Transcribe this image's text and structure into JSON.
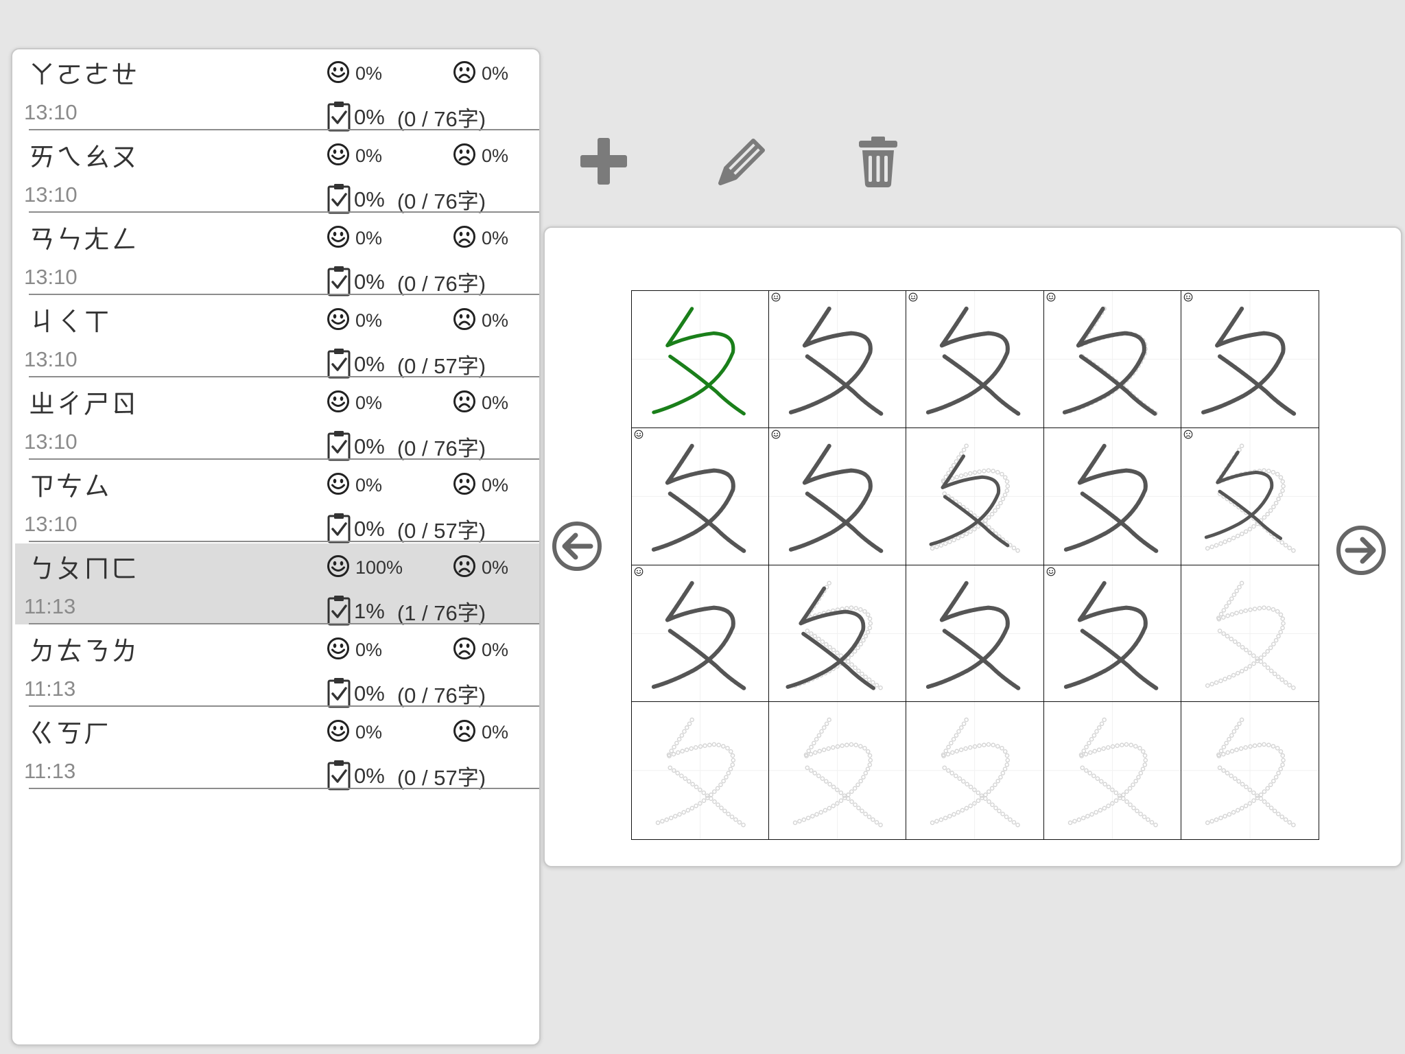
{
  "lessons": [
    {
      "title": "ㄚㄛㄜㄝ",
      "time": "13:10",
      "happy": "0%",
      "sad": "0%",
      "done": "0%",
      "count": "(0 / 76字)",
      "selected": false
    },
    {
      "title": "ㄞㄟㄠㄡ",
      "time": "13:10",
      "happy": "0%",
      "sad": "0%",
      "done": "0%",
      "count": "(0 / 76字)",
      "selected": false
    },
    {
      "title": "ㄢㄣㄤㄥ",
      "time": "13:10",
      "happy": "0%",
      "sad": "0%",
      "done": "0%",
      "count": "(0 / 76字)",
      "selected": false
    },
    {
      "title": "ㄐㄑㄒ",
      "time": "13:10",
      "happy": "0%",
      "sad": "0%",
      "done": "0%",
      "count": "(0 / 57字)",
      "selected": false
    },
    {
      "title": "ㄓㄔㄕㄖ",
      "time": "13:10",
      "happy": "0%",
      "sad": "0%",
      "done": "0%",
      "count": "(0 / 76字)",
      "selected": false
    },
    {
      "title": "ㄗㄘㄙ",
      "time": "13:10",
      "happy": "0%",
      "sad": "0%",
      "done": "0%",
      "count": "(0 / 57字)",
      "selected": false
    },
    {
      "title": "ㄅㄆㄇㄈ",
      "time": "11:13",
      "happy": "100%",
      "sad": "0%",
      "done": "1%",
      "count": "(1 / 76字)",
      "selected": true
    },
    {
      "title": "ㄉㄊㄋㄌ",
      "time": "11:13",
      "happy": "0%",
      "sad": "0%",
      "done": "0%",
      "count": "(0 / 76字)",
      "selected": false
    },
    {
      "title": "ㄍㄎㄏ",
      "time": "11:13",
      "happy": "0%",
      "sad": "0%",
      "done": "0%",
      "count": "(0 / 57字)",
      "selected": false
    }
  ],
  "toolbar": {
    "add_icon": "plus-icon",
    "edit_icon": "pencil-icon",
    "delete_icon": "trash-icon"
  },
  "practice": {
    "character": "ㄆ",
    "cells": [
      "example",
      "written",
      "written",
      "written",
      "written",
      "written",
      "written",
      "written",
      "written",
      "written",
      "written",
      "written",
      "written",
      "written",
      "empty",
      "empty",
      "empty",
      "empty",
      "empty",
      "empty"
    ],
    "badges": [
      "none",
      "happy",
      "happy",
      "happy",
      "happy",
      "happy",
      "happy",
      "none",
      "none",
      "sad",
      "happy",
      "none",
      "none",
      "happy",
      "none",
      "none",
      "none",
      "none",
      "none",
      "none"
    ],
    "colors": {
      "example_stroke": "#1a7f1a",
      "written_stroke": "#555555",
      "guide_dots": "#d4d4d4"
    }
  },
  "nav": {
    "prev_icon": "arrow-left-circle-icon",
    "next_icon": "arrow-right-circle-icon"
  }
}
